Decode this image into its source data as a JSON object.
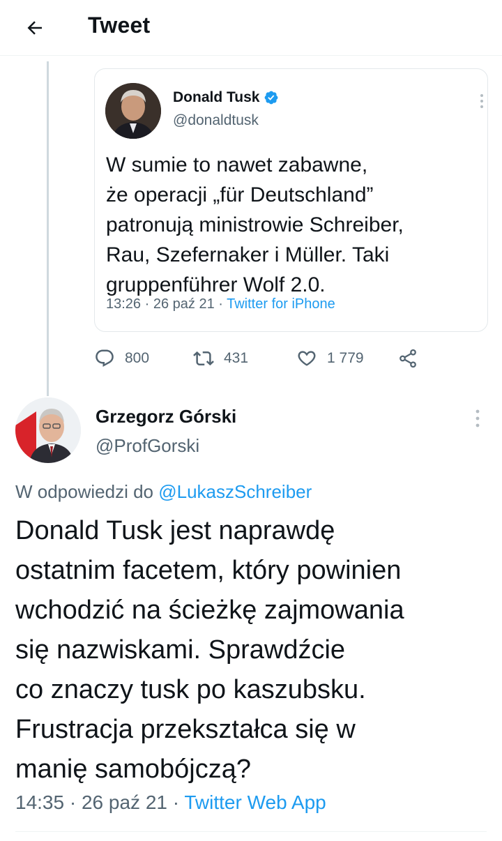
{
  "header": {
    "title": "Tweet",
    "back_icon": "arrow-left-icon"
  },
  "quoted_tweet": {
    "author_name": "Donald Tusk",
    "author_handle": "@donaldtusk",
    "verified": true,
    "text_lines": [
      "W sumie to nawet zabawne,",
      "że operacji „für Deutschland”",
      "patronują ministrowie Schreiber,",
      "Rau, Szefernaker i Müller. Taki",
      "gruppenführer Wolf 2.0."
    ],
    "time": "13:26",
    "date": "26 paź 21",
    "app": "Twitter for iPhone"
  },
  "actions": {
    "reply_count": "800",
    "retweet_count": "431",
    "like_count": "1 779"
  },
  "reply_tweet": {
    "author_name": "Grzegorz Górski",
    "author_handle": "@ProfGorski",
    "reply_to_label": "W odpowiedzi do",
    "reply_to_handle": "@LukaszSchreiber",
    "text_lines": [
      "Donald Tusk jest naprawdę",
      "ostatnim facetem, który powinien",
      "wchodzić na ścieżkę zajmowania",
      "się nazwiskami. Sprawdźcie",
      "co znaczy tusk po kaszubsku.",
      "Frustracja przekształca się w",
      "manię samobójczą?"
    ],
    "time": "14:35",
    "date": "26 paź 21",
    "app": "Twitter Web App"
  },
  "colors": {
    "accent": "#1d9bf0",
    "muted": "#536471",
    "text": "#0f1419"
  }
}
